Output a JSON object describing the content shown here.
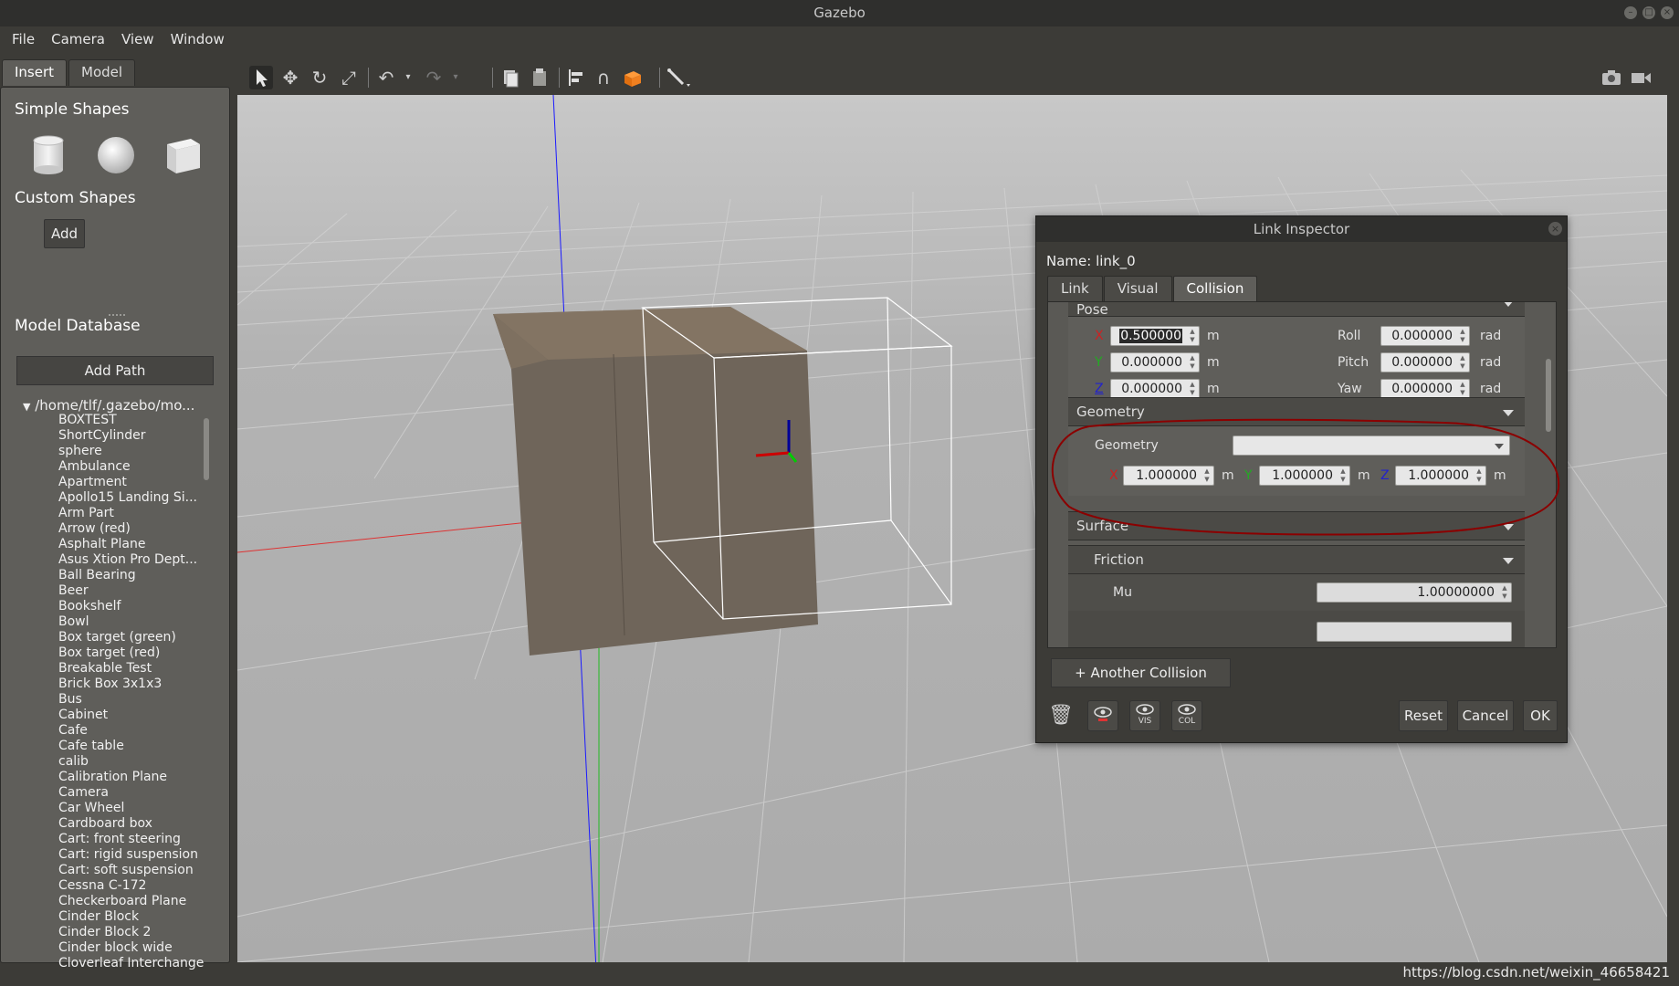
{
  "window": {
    "title": "Gazebo"
  },
  "menu": {
    "file": "File",
    "camera": "Camera",
    "view": "View",
    "window": "Window"
  },
  "left_panel": {
    "tabs": [
      "Insert",
      "Model"
    ],
    "simple_shapes_title": "Simple Shapes",
    "custom_shapes_title": "Custom Shapes",
    "add_label": "Add",
    "model_database_title": "Model Database",
    "add_path_label": "Add Path",
    "tree_root": "/home/tlf/.gazebo/mo...",
    "models": [
      "BOXTEST",
      "ShortCylinder",
      "sphere",
      "Ambulance",
      "Apartment",
      "Apollo15 Landing Si...",
      "Arm Part",
      "Arrow (red)",
      "Asphalt Plane",
      "Asus Xtion Pro Dept...",
      "Ball Bearing",
      "Beer",
      "Bookshelf",
      "Bowl",
      "Box target (green)",
      "Box target (red)",
      "Breakable Test",
      "Brick Box 3x1x3",
      "Bus",
      "Cabinet",
      "Cafe",
      "Cafe table",
      "calib",
      "Calibration Plane",
      "Camera",
      "Car Wheel",
      "Cardboard box",
      "Cart: front steering",
      "Cart: rigid suspension",
      "Cart: soft suspension",
      "Cessna C-172",
      "Checkerboard Plane",
      "Cinder Block",
      "Cinder Block 2",
      "Cinder block wide",
      "Cloverleaf Interchange"
    ]
  },
  "inspector": {
    "title": "Link Inspector",
    "name_label": "Name:",
    "name_value": "link_0",
    "tabs": [
      "Link",
      "Visual",
      "Collision"
    ],
    "pose_title": "Pose",
    "pose": {
      "x_label": "X",
      "x_value": "0.500000",
      "y_label": "Y",
      "y_value": "0.000000",
      "z_label": "Z",
      "z_value": "0.000000",
      "roll_label": "Roll",
      "roll_value": "0.000000",
      "pitch_label": "Pitch",
      "pitch_value": "0.000000",
      "yaw_label": "Yaw",
      "yaw_value": "0.000000",
      "unit_m": "m",
      "unit_rad": "rad"
    },
    "geometry_title": "Geometry",
    "geometry_label": "Geometry",
    "size": {
      "x_label": "X",
      "x_value": "1.000000",
      "y_label": "Y",
      "y_value": "1.000000",
      "z_label": "Z",
      "z_value": "1.000000",
      "unit_m": "m"
    },
    "surface_title": "Surface",
    "friction_title": "Friction",
    "mu_label": "Mu",
    "mu_value": "1.00000000",
    "another_collision": "+ Another Collision",
    "vis_label": "VIS",
    "col_label": "COL",
    "reset": "Reset",
    "cancel": "Cancel",
    "ok": "OK"
  },
  "watermark": "https://blog.csdn.net/weixin_46658421",
  "colors": {
    "accent_red": "#8b0000",
    "axis_x": "#cc0000",
    "axis_y": "#00aa00",
    "axis_z": "#0000cc"
  }
}
